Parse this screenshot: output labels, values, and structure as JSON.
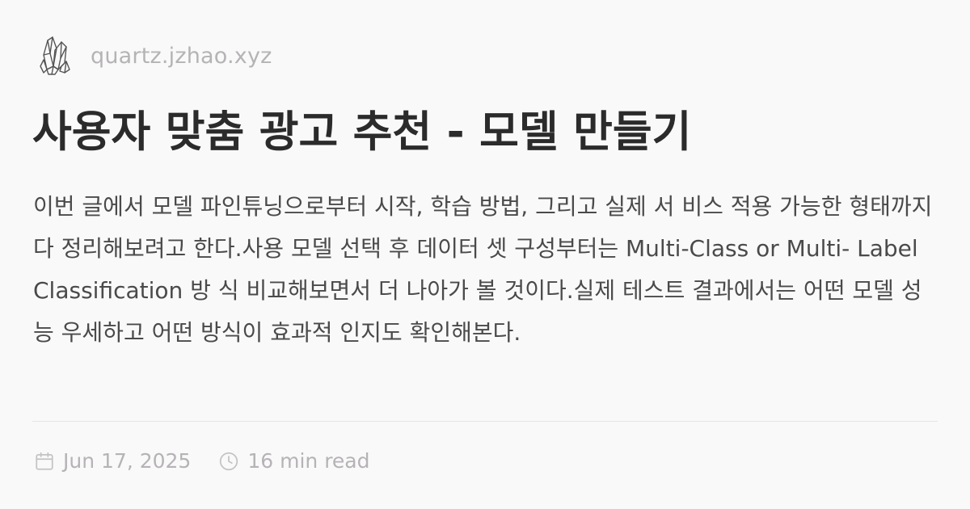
{
  "site": {
    "logo_icon": "crystal-cluster-icon",
    "name": "quartz.jzhao.xyz"
  },
  "page": {
    "title": "사용자 맞춤 광고 추천 - 모델 만들기",
    "description": "이번 글에서 모델 파인튜닝으로부터 시작, 학습 방법, 그리고 실제 서 비스 적용 가능한 형태까지 다 정리해보려고 한다.사용 모델 선택 후 데이터 셋 구성부터는 Multi-Class or Multi- Label Classification 방 식 비교해보면서 더 나아가 볼 것이다.실제 테스트 결과에서는 어떤 모델 성능 우세하고 어떤 방식이 효과적 인지도 확인해본다."
  },
  "meta": {
    "calendar_icon": "calendar-icon",
    "date": "Jun 17, 2025",
    "clock_icon": "clock-icon",
    "reading_time": "16 min read"
  },
  "colors": {
    "background": "#faf9fa",
    "title": "#2b2b2b",
    "body_text": "#4a4a4a",
    "muted": "#b5b3b5",
    "divider": "#e6e4e6"
  }
}
